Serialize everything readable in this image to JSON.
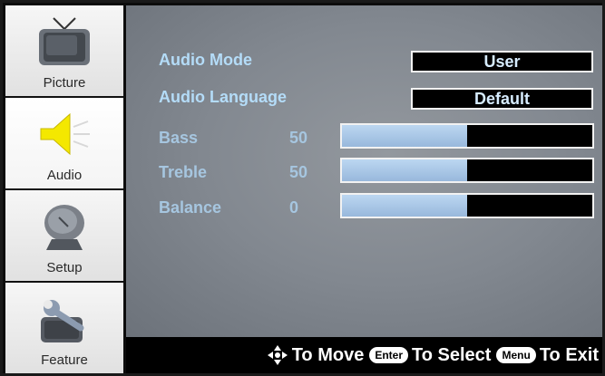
{
  "sidebar": {
    "items": [
      {
        "label": "Picture",
        "icon": "tv-icon"
      },
      {
        "label": "Audio",
        "icon": "speaker-icon",
        "active": true
      },
      {
        "label": "Setup",
        "icon": "satellite-dish-icon"
      },
      {
        "label": "Feature",
        "icon": "wrench-icon"
      }
    ]
  },
  "main": {
    "audio_mode": {
      "label": "Audio Mode",
      "value": "User"
    },
    "audio_language": {
      "label": "Audio Language",
      "value": "Default"
    },
    "bass": {
      "label": "Bass",
      "value": "50",
      "level": 0.5
    },
    "treble": {
      "label": "Treble",
      "value": "50",
      "level": 0.5
    },
    "balance": {
      "label": "Balance",
      "value": "0",
      "level": 0.5
    }
  },
  "footer": {
    "move_text": "To Move",
    "enter_key": "Enter",
    "select_text": "To Select",
    "menu_key": "Menu",
    "exit_text": "To Exit"
  },
  "colors": {
    "label_active": "#b4dcf8",
    "label_dim": "#a6c6e0",
    "slider_fill": "#a8c6e6",
    "panel": "#858b93"
  }
}
